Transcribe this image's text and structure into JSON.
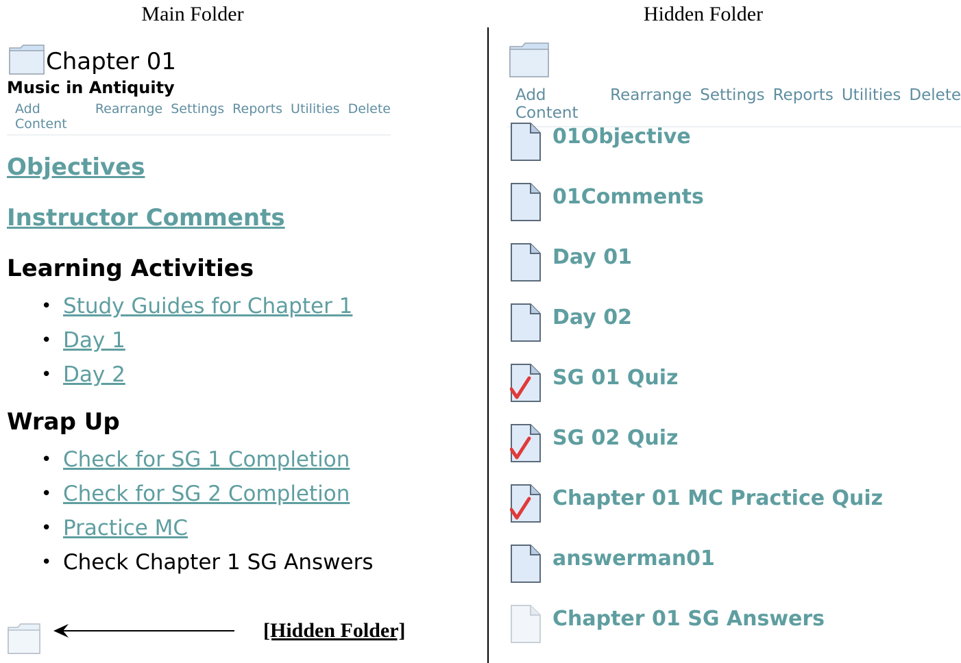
{
  "captions": {
    "main": "Main Folder",
    "hidden": "Hidden Folder"
  },
  "main": {
    "title": "Chapter 01",
    "subtitle": "Music in Antiquity",
    "toolbar": [
      "Add Content",
      "Rearrange",
      "Settings",
      "Reports",
      "Utilities",
      "Delete"
    ],
    "objectives": "Objectives",
    "instructor_comments": "Instructor Comments",
    "learning_heading": "Learning Activities",
    "learning_items": [
      "Study Guides for Chapter 1",
      "Day 1",
      "Day 2"
    ],
    "wrap_heading": "Wrap Up",
    "wrap_items": [
      "Check for SG 1 Completion",
      "Check for SG 2 Completion",
      "Practice MC"
    ],
    "wrap_plain": "Check Chapter 1 SG Answers",
    "hidden_label": "[Hidden Folder]",
    "bullet": "•"
  },
  "hidden": {
    "toolbar": [
      "Add Content",
      "Rearrange",
      "Settings",
      "Reports",
      "Utilities",
      "Delete"
    ],
    "items": [
      {
        "label": "01Objective",
        "icon": "document-icon"
      },
      {
        "label": "01Comments",
        "icon": "document-icon"
      },
      {
        "label": "Day 01",
        "icon": "document-icon"
      },
      {
        "label": "Day 02",
        "icon": "document-icon"
      },
      {
        "label": "SG 01 Quiz",
        "icon": "quiz-check-icon"
      },
      {
        "label": "SG 02 Quiz",
        "icon": "quiz-check-icon"
      },
      {
        "label": "Chapter 01 MC Practice Quiz",
        "icon": "quiz-check-icon"
      },
      {
        "label": "answerman01",
        "icon": "document-icon"
      },
      {
        "label": "Chapter 01 SG Answers",
        "icon": "faded-document-icon"
      }
    ]
  },
  "colors": {
    "link": "#5f9ea0",
    "toolbar": "#5f8ea0",
    "check": "#e03a3a"
  }
}
